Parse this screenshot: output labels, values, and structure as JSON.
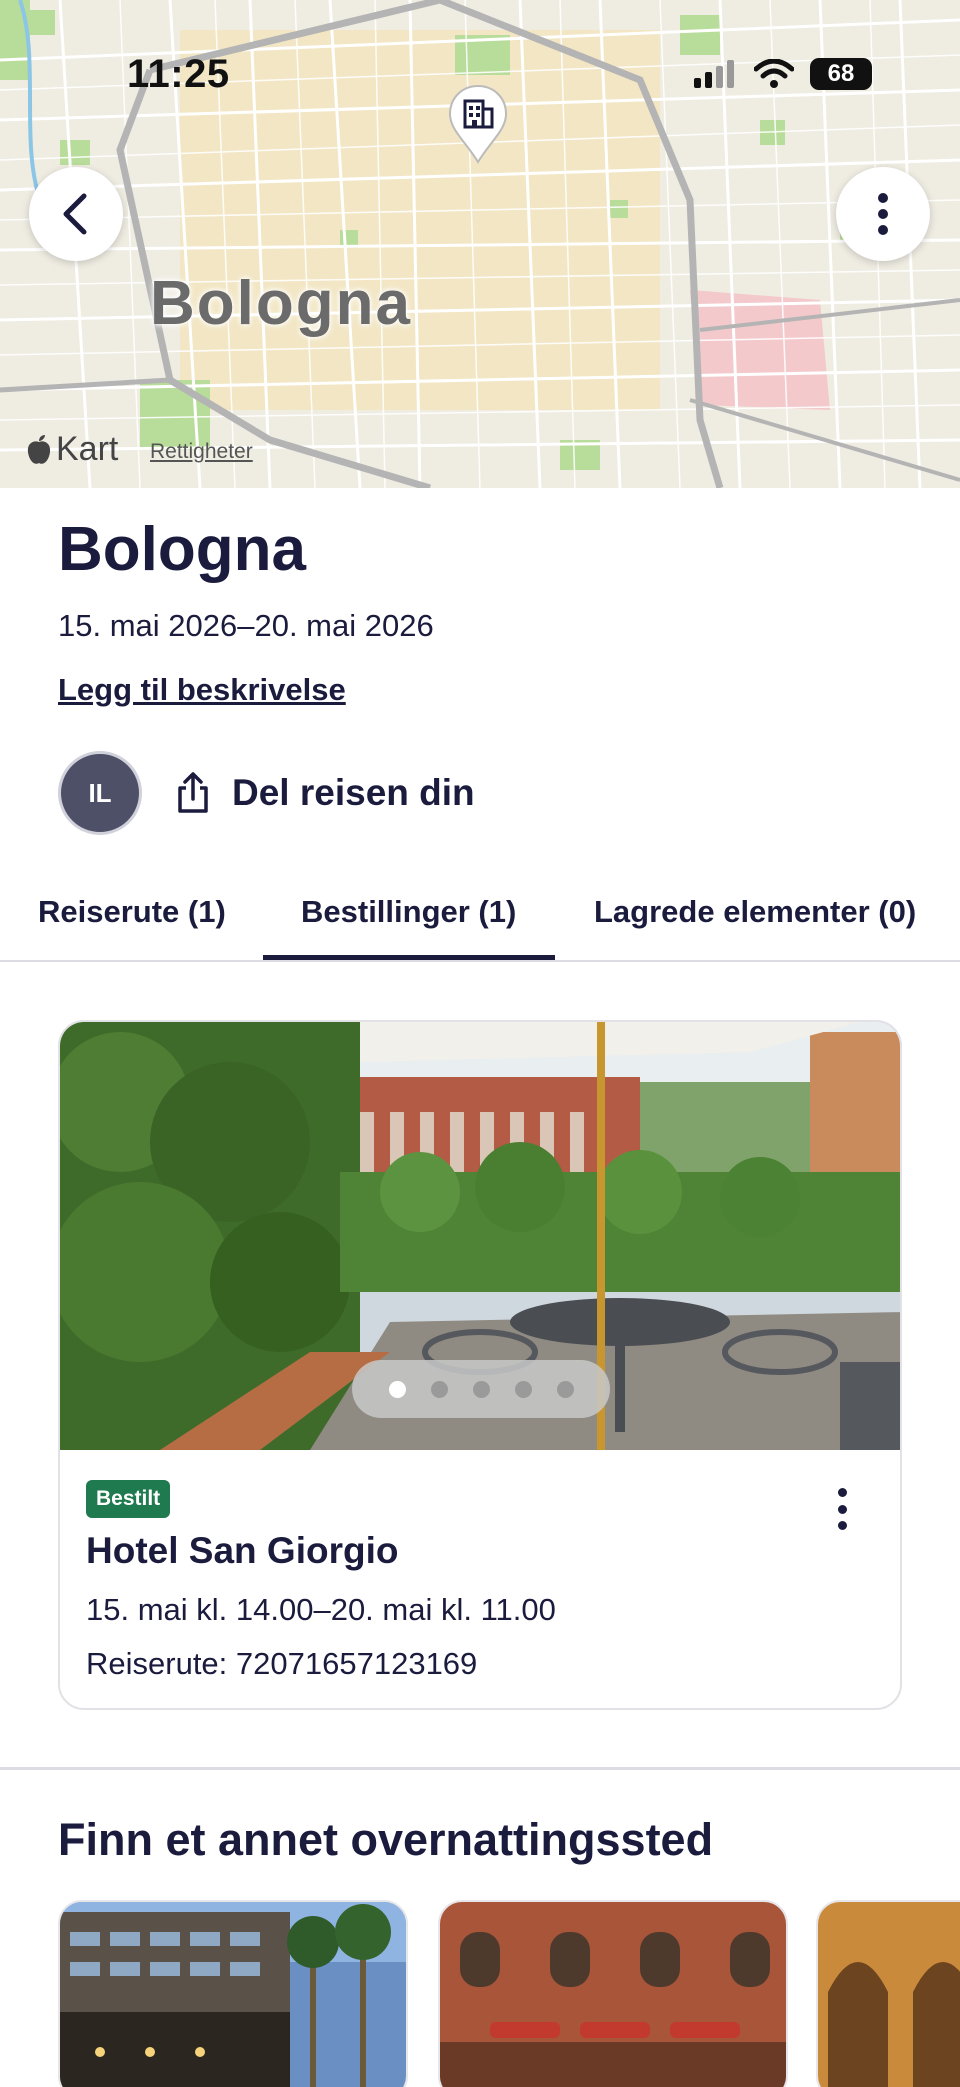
{
  "status_bar": {
    "time": "11:25",
    "battery": "68"
  },
  "map": {
    "city_label": "Bologna",
    "brand": "Kart",
    "rights": "Rettigheter",
    "back_icon": "chevron-left-icon",
    "more_icon": "more-vertical-icon",
    "pin_icon": "building-icon"
  },
  "trip": {
    "title": "Bologna",
    "dates": "15. mai 2026–20. mai 2026",
    "add_description": "Legg til beskrivelse",
    "avatar_initials": "IL",
    "share_label": "Del reisen din"
  },
  "tabs": [
    {
      "label": "Reiserute (1)",
      "active": false
    },
    {
      "label": "Bestillinger (1)",
      "active": true
    },
    {
      "label": "Lagrede elementer (0)",
      "active": false
    }
  ],
  "booking": {
    "status_badge": "Bestilt",
    "hotel_name": "Hotel San Giorgio",
    "time_range": "15. mai kl. 14.00–20. mai kl. 11.00",
    "itinerary_label": "Reiserute:",
    "itinerary_number": "72071657123169",
    "photo_count": 5,
    "photo_index": 1
  },
  "section": {
    "title": "Finn et annet overnattingssted"
  },
  "colors": {
    "text": "#1a1b3d",
    "badge": "#1f7a4f",
    "avatar": "#4e5068"
  }
}
